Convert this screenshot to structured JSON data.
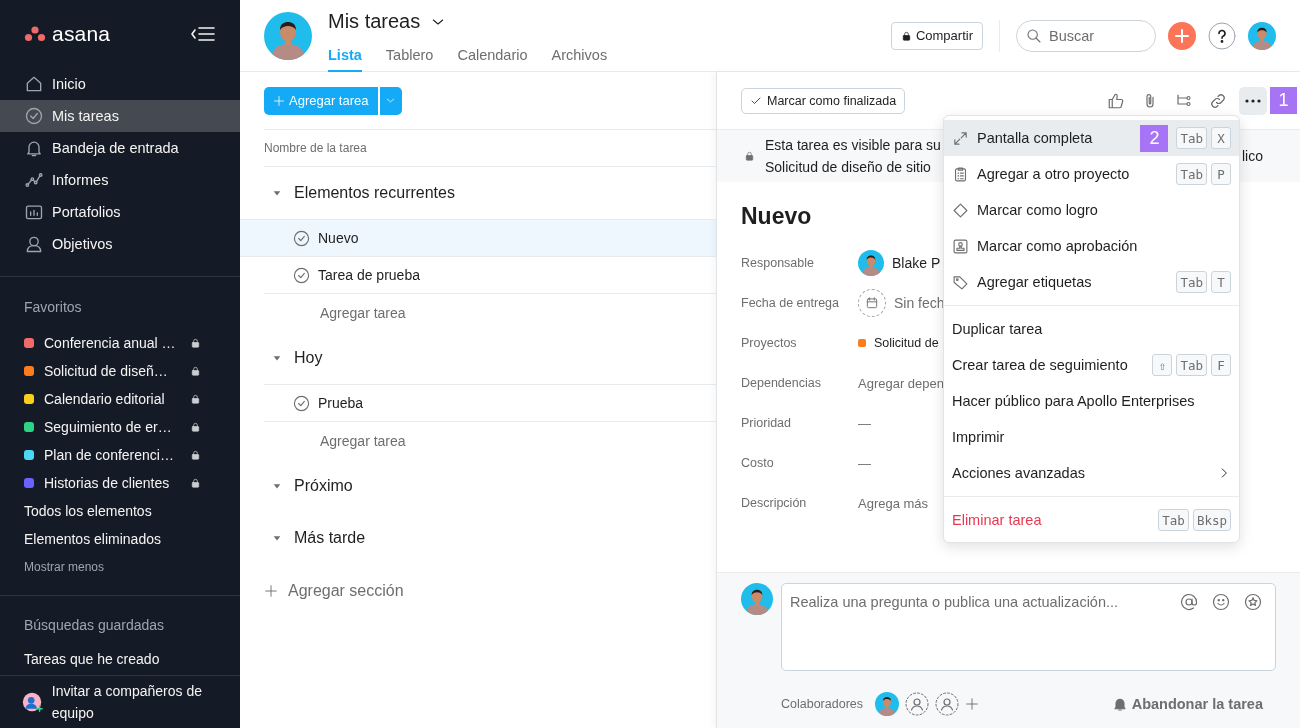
{
  "sidebar": {
    "logo": "asana",
    "nav": [
      {
        "label": "Inicio",
        "selected": false
      },
      {
        "label": "Mis tareas",
        "selected": true
      },
      {
        "label": "Bandeja de entrada",
        "selected": false
      },
      {
        "label": "Informes",
        "selected": false
      },
      {
        "label": "Portafolios",
        "selected": false
      },
      {
        "label": "Objetivos",
        "selected": false
      }
    ],
    "favorites_heading": "Favoritos",
    "favorites": [
      {
        "label": "Conferencia anual …",
        "color": "#f06a6a"
      },
      {
        "label": "Solicitud de diseñ…",
        "color": "#fd7d1d"
      },
      {
        "label": "Calendario editorial",
        "color": "#f8d01c"
      },
      {
        "label": "Seguimiento de er…",
        "color": "#2ed486"
      },
      {
        "label": "Plan de conferenci…",
        "color": "#4ad8f5"
      },
      {
        "label": "Historias de clientes",
        "color": "#6b63ff"
      }
    ],
    "links": [
      "Todos los elementos",
      "Elementos eliminados"
    ],
    "show_less": "Mostrar menos",
    "saved_heading": "Búsquedas guardadas",
    "saved": [
      "Tareas que he creado"
    ],
    "invite": "Invitar a compañeros de equipo"
  },
  "header": {
    "title": "Mis tareas",
    "tabs": [
      {
        "label": "Lista",
        "selected": true
      },
      {
        "label": "Tablero",
        "selected": false
      },
      {
        "label": "Calendario",
        "selected": false
      },
      {
        "label": "Archivos",
        "selected": false
      }
    ],
    "share": "Compartir",
    "search_placeholder": "Buscar"
  },
  "list": {
    "add_button": "Agregar tarea",
    "column": "Nombre de la tarea",
    "sections": [
      {
        "title": "Elementos recurrentes",
        "expanded": true,
        "tasks": [
          {
            "name": "Nuevo",
            "selected": true
          },
          {
            "name": "Tarea de prueba",
            "selected": false
          }
        ],
        "add": "Agregar tarea"
      },
      {
        "title": "Hoy",
        "expanded": true,
        "tasks": [
          {
            "name": "Prueba",
            "selected": false
          }
        ],
        "add": "Agregar tarea"
      },
      {
        "title": "Próximo",
        "expanded": true
      },
      {
        "title": "Más tarde",
        "expanded": true
      }
    ],
    "add_section": "Agregar sección"
  },
  "detail": {
    "complete_button": "Marcar como finalizada",
    "callout": "1",
    "notice": [
      "Esta tarea es visible para su",
      "Solicitud de diseño de sitio"
    ],
    "notice_tail": "lico",
    "title": "Nuevo",
    "fields": [
      {
        "label": "Responsable",
        "kind": "person",
        "value": "Blake P"
      },
      {
        "label": "Fecha de entrega",
        "kind": "date",
        "value": "Sin fech"
      },
      {
        "label": "Proyectos",
        "kind": "project",
        "value": "Solicitud de",
        "color": "#fd7d1d"
      },
      {
        "label": "Dependencias",
        "kind": "plain",
        "value": "Agregar depen"
      },
      {
        "label": "Prioridad",
        "kind": "plain",
        "value": "—"
      },
      {
        "label": "Costo",
        "kind": "plain",
        "value": "—"
      },
      {
        "label": "Descripción",
        "kind": "plain",
        "value": "Agrega más"
      }
    ],
    "comment_placeholder": "Realiza una pregunta o publica una actualización...",
    "collaborators_label": "Colaboradores",
    "leave": "Abandonar la tarea"
  },
  "menu": {
    "groups": [
      [
        {
          "label": "Pantalla completa",
          "keys": [
            "Tab",
            "X"
          ],
          "selected": true,
          "danger": false,
          "submenu": false,
          "callout": "2"
        },
        {
          "label": "Agregar a otro proyecto",
          "keys": [
            "Tab",
            "P"
          ],
          "selected": false,
          "danger": false,
          "submenu": false
        },
        {
          "label": "Marcar como logro",
          "selected": false,
          "danger": false,
          "submenu": false
        },
        {
          "label": "Marcar como aprobación",
          "selected": false,
          "danger": false,
          "submenu": false
        },
        {
          "label": "Agregar etiquetas",
          "keys": [
            "Tab",
            "T"
          ],
          "selected": false,
          "danger": false,
          "submenu": false
        }
      ],
      [
        {
          "label": "Duplicar tarea",
          "selected": false,
          "danger": false,
          "submenu": false
        },
        {
          "label": "Crear tarea de seguimiento",
          "keys": [
            "⇧",
            "Tab",
            "F"
          ],
          "selected": false,
          "danger": false,
          "submenu": false
        },
        {
          "label": "Hacer público para Apollo Enterprises",
          "selected": false,
          "danger": false,
          "submenu": false
        },
        {
          "label": "Imprimir",
          "selected": false,
          "danger": false,
          "submenu": false
        },
        {
          "label": "Acciones avanzadas",
          "selected": false,
          "danger": false,
          "submenu": true
        }
      ],
      [
        {
          "label": "Eliminar tarea",
          "keys": [
            "Tab",
            "Bksp"
          ],
          "selected": false,
          "danger": true,
          "submenu": false
        }
      ]
    ]
  }
}
